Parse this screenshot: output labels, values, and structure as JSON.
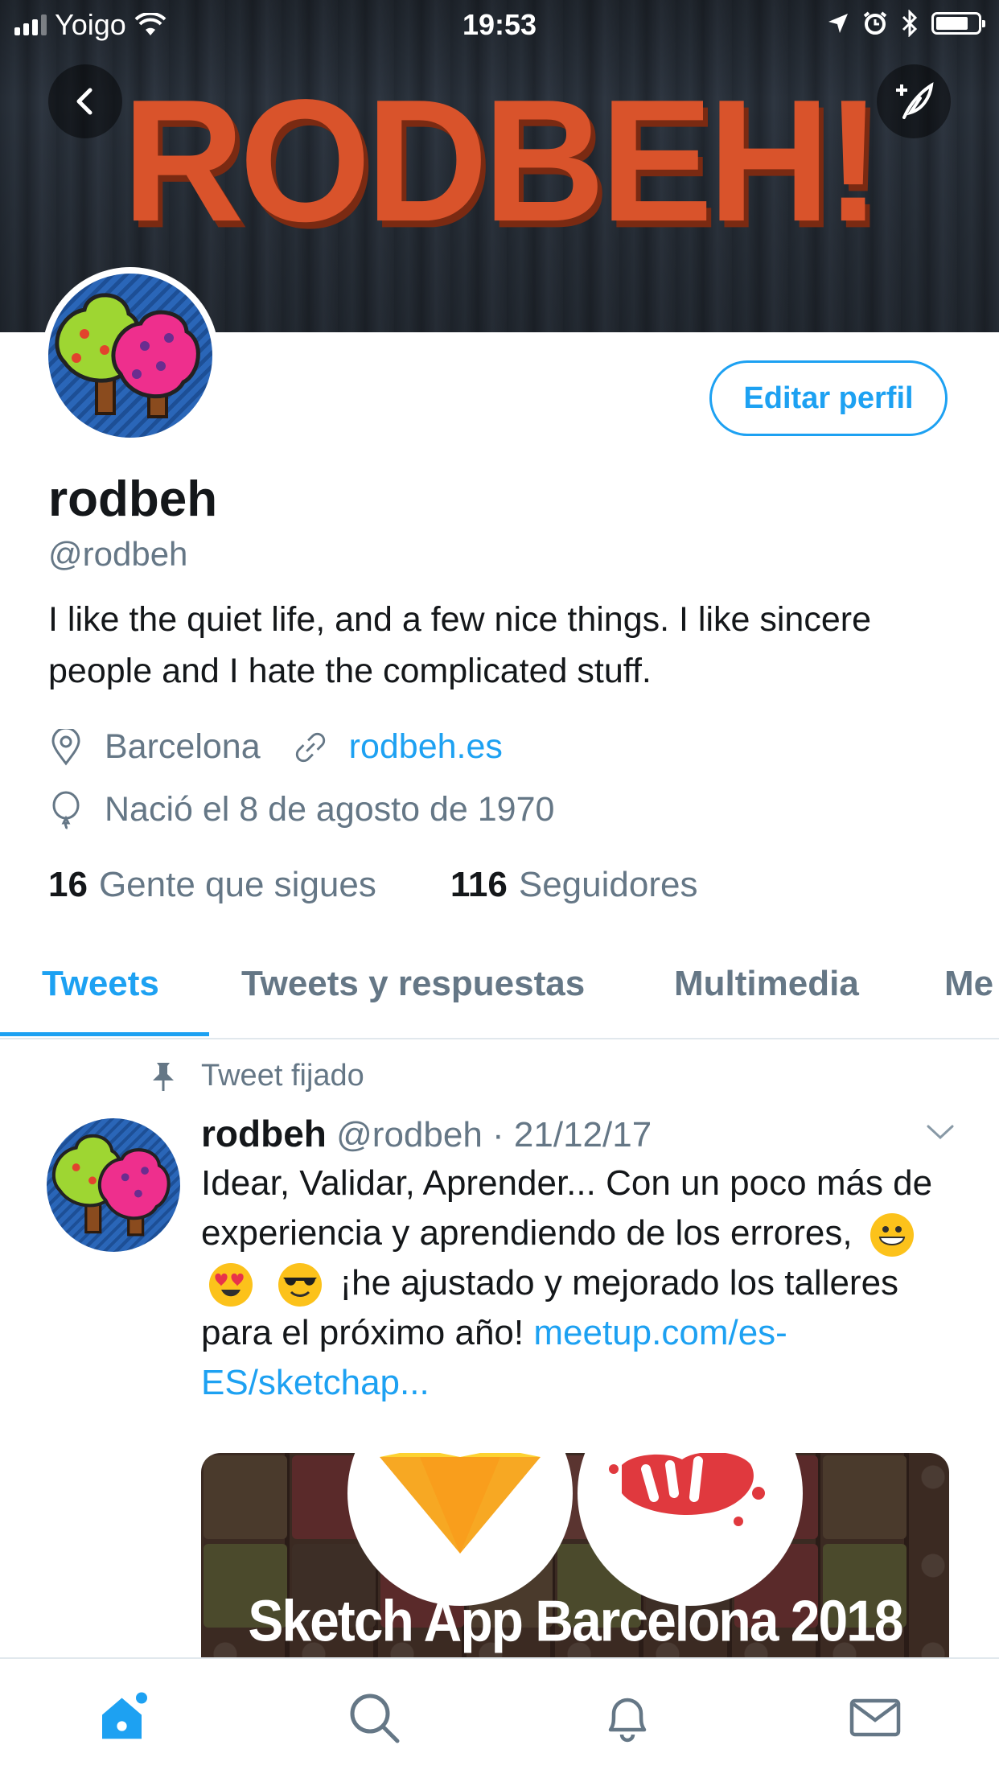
{
  "status_bar": {
    "carrier": "Yoigo",
    "time": "19:53",
    "signal_bars_filled": 3,
    "signal_bars_total": 4,
    "battery_level": 0.7
  },
  "header": {
    "banner_text": "RODBEH!",
    "back_icon": "chevron-left-icon",
    "compose_icon": "compose-tweet-icon"
  },
  "profile": {
    "edit_button_label": "Editar perfil",
    "name": "rodbeh",
    "handle": "@rodbeh",
    "bio": "I like the quiet life, and a few nice things. I like sincere people and I hate the complicated stuff.",
    "location": "Barcelona",
    "website": "rodbeh.es",
    "birthday": "Nació el 8 de agosto de 1970",
    "following_count": "16",
    "following_label": "Gente que sigues",
    "followers_count": "116",
    "followers_label": "Seguidores"
  },
  "tabs": [
    {
      "label": "Tweets",
      "active": true
    },
    {
      "label": "Tweets y respuestas",
      "active": false
    },
    {
      "label": "Multimedia",
      "active": false
    },
    {
      "label": "Me",
      "active": false
    }
  ],
  "tweet": {
    "pinned_label": "Tweet fijado",
    "author_name": "rodbeh",
    "author_handle": "@rodbeh",
    "separator": "·",
    "date": "21/12/17",
    "text_part1": "Idear, Validar, Aprender... Con un poco más de experiencia y aprendiendo de los errores,",
    "text_part2": "¡he ajustado y mejorado los talleres para el próximo año!",
    "link": "meetup.com/es-ES/sketchap...",
    "card_title": "Sketch App Barcelona 2018"
  },
  "bottom_tabs": [
    {
      "icon": "home-icon",
      "active": true,
      "has_dot": true
    },
    {
      "icon": "search-icon",
      "active": false
    },
    {
      "icon": "notifications-bell-icon",
      "active": false
    },
    {
      "icon": "messages-envelope-icon",
      "active": false
    }
  ],
  "colors": {
    "accent": "#1da1f2",
    "text": "#14171a",
    "muted": "#657786",
    "banner_text": "#d9532b"
  }
}
